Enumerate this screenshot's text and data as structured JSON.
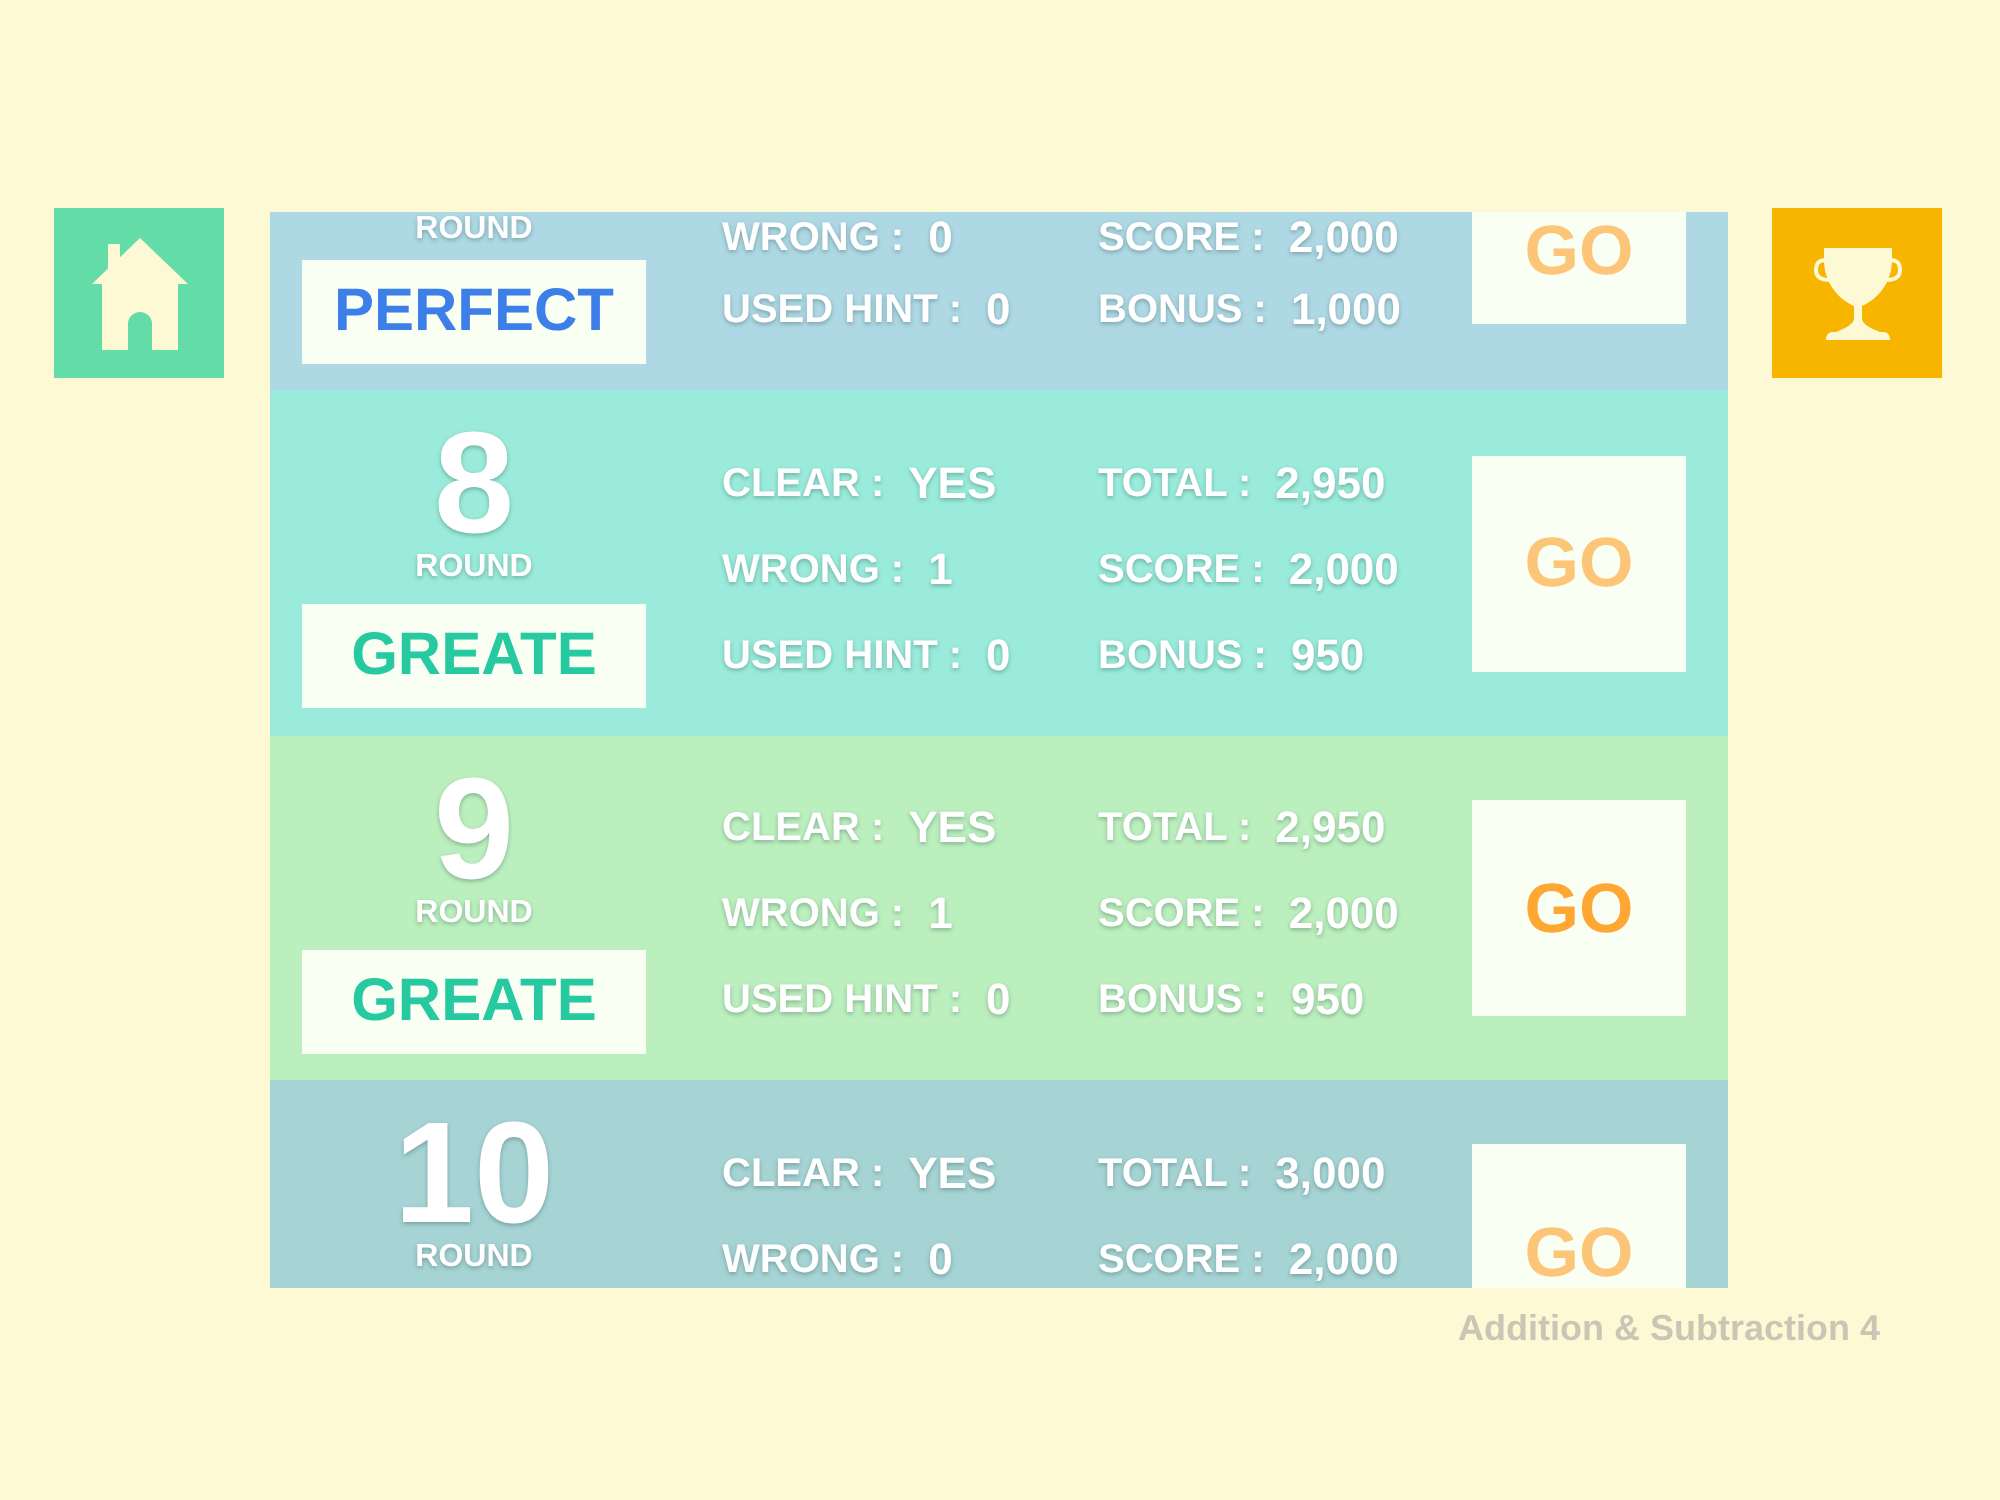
{
  "rounds": [
    {
      "color": "#aed8e4",
      "round_label": "ROUND",
      "badge": {
        "text": "PERFECT",
        "color": "#3d7fe8"
      },
      "stats_left": [
        {
          "label": "WRONG :",
          "value": "0"
        },
        {
          "label": "USED HINT :",
          "value": "0"
        }
      ],
      "stats_right": [
        {
          "label": "SCORE :",
          "value": "2,000"
        },
        {
          "label": "BONUS :",
          "value": "1,000"
        }
      ],
      "go": {
        "text": "GO",
        "highlighted": false
      }
    },
    {
      "color": "#9aebdb",
      "number": "8",
      "round_label": "ROUND",
      "badge": {
        "text": "GREATE",
        "color": "#27c9a1"
      },
      "stats_left": [
        {
          "label": "CLEAR :",
          "value": "YES"
        },
        {
          "label": "WRONG :",
          "value": "1"
        },
        {
          "label": "USED HINT :",
          "value": "0"
        }
      ],
      "stats_right": [
        {
          "label": "TOTAL :",
          "value": "2,950"
        },
        {
          "label": "SCORE :",
          "value": "2,000"
        },
        {
          "label": "BONUS :",
          "value": "950"
        }
      ],
      "go": {
        "text": "GO",
        "highlighted": false
      }
    },
    {
      "color": "#bcefbe",
      "number": "9",
      "round_label": "ROUND",
      "badge": {
        "text": "GREATE",
        "color": "#27c9a1"
      },
      "stats_left": [
        {
          "label": "CLEAR :",
          "value": "YES"
        },
        {
          "label": "WRONG :",
          "value": "1"
        },
        {
          "label": "USED HINT :",
          "value": "0"
        }
      ],
      "stats_right": [
        {
          "label": "TOTAL :",
          "value": "2,950"
        },
        {
          "label": "SCORE :",
          "value": "2,000"
        },
        {
          "label": "BONUS :",
          "value": "950"
        }
      ],
      "go": {
        "text": "GO",
        "highlighted": true
      }
    },
    {
      "color": "#a6d3d4",
      "number": "10",
      "round_label": "ROUND",
      "stats_left": [
        {
          "label": "CLEAR :",
          "value": "YES"
        },
        {
          "label": "WRONG :",
          "value": "0"
        }
      ],
      "stats_right": [
        {
          "label": "TOTAL :",
          "value": "3,000"
        },
        {
          "label": "SCORE :",
          "value": "2,000"
        }
      ],
      "go": {
        "text": "GO",
        "highlighted": false
      }
    }
  ],
  "footer": "Addition & Subtraction 4"
}
